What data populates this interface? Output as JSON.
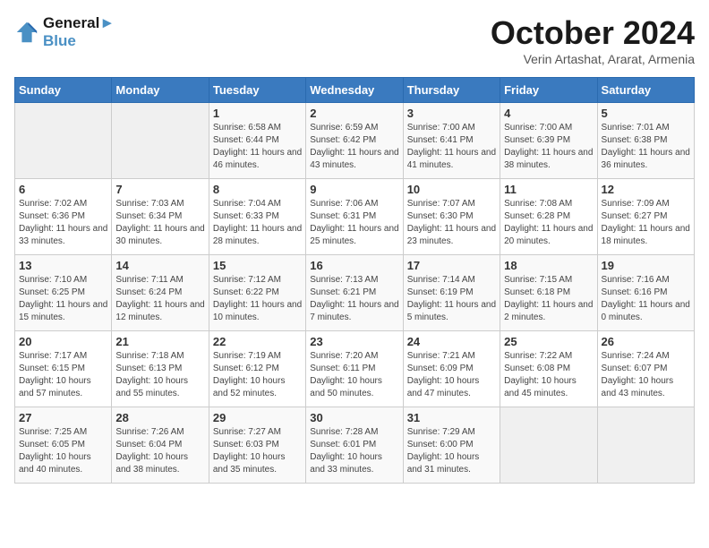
{
  "header": {
    "logo_line1": "General",
    "logo_line2": "Blue",
    "month": "October 2024",
    "location": "Verin Artashat, Ararat, Armenia"
  },
  "days_of_week": [
    "Sunday",
    "Monday",
    "Tuesday",
    "Wednesday",
    "Thursday",
    "Friday",
    "Saturday"
  ],
  "weeks": [
    [
      {
        "day": "",
        "info": ""
      },
      {
        "day": "",
        "info": ""
      },
      {
        "day": "1",
        "info": "Sunrise: 6:58 AM\nSunset: 6:44 PM\nDaylight: 11 hours and 46 minutes."
      },
      {
        "day": "2",
        "info": "Sunrise: 6:59 AM\nSunset: 6:42 PM\nDaylight: 11 hours and 43 minutes."
      },
      {
        "day": "3",
        "info": "Sunrise: 7:00 AM\nSunset: 6:41 PM\nDaylight: 11 hours and 41 minutes."
      },
      {
        "day": "4",
        "info": "Sunrise: 7:00 AM\nSunset: 6:39 PM\nDaylight: 11 hours and 38 minutes."
      },
      {
        "day": "5",
        "info": "Sunrise: 7:01 AM\nSunset: 6:38 PM\nDaylight: 11 hours and 36 minutes."
      }
    ],
    [
      {
        "day": "6",
        "info": "Sunrise: 7:02 AM\nSunset: 6:36 PM\nDaylight: 11 hours and 33 minutes."
      },
      {
        "day": "7",
        "info": "Sunrise: 7:03 AM\nSunset: 6:34 PM\nDaylight: 11 hours and 30 minutes."
      },
      {
        "day": "8",
        "info": "Sunrise: 7:04 AM\nSunset: 6:33 PM\nDaylight: 11 hours and 28 minutes."
      },
      {
        "day": "9",
        "info": "Sunrise: 7:06 AM\nSunset: 6:31 PM\nDaylight: 11 hours and 25 minutes."
      },
      {
        "day": "10",
        "info": "Sunrise: 7:07 AM\nSunset: 6:30 PM\nDaylight: 11 hours and 23 minutes."
      },
      {
        "day": "11",
        "info": "Sunrise: 7:08 AM\nSunset: 6:28 PM\nDaylight: 11 hours and 20 minutes."
      },
      {
        "day": "12",
        "info": "Sunrise: 7:09 AM\nSunset: 6:27 PM\nDaylight: 11 hours and 18 minutes."
      }
    ],
    [
      {
        "day": "13",
        "info": "Sunrise: 7:10 AM\nSunset: 6:25 PM\nDaylight: 11 hours and 15 minutes."
      },
      {
        "day": "14",
        "info": "Sunrise: 7:11 AM\nSunset: 6:24 PM\nDaylight: 11 hours and 12 minutes."
      },
      {
        "day": "15",
        "info": "Sunrise: 7:12 AM\nSunset: 6:22 PM\nDaylight: 11 hours and 10 minutes."
      },
      {
        "day": "16",
        "info": "Sunrise: 7:13 AM\nSunset: 6:21 PM\nDaylight: 11 hours and 7 minutes."
      },
      {
        "day": "17",
        "info": "Sunrise: 7:14 AM\nSunset: 6:19 PM\nDaylight: 11 hours and 5 minutes."
      },
      {
        "day": "18",
        "info": "Sunrise: 7:15 AM\nSunset: 6:18 PM\nDaylight: 11 hours and 2 minutes."
      },
      {
        "day": "19",
        "info": "Sunrise: 7:16 AM\nSunset: 6:16 PM\nDaylight: 11 hours and 0 minutes."
      }
    ],
    [
      {
        "day": "20",
        "info": "Sunrise: 7:17 AM\nSunset: 6:15 PM\nDaylight: 10 hours and 57 minutes."
      },
      {
        "day": "21",
        "info": "Sunrise: 7:18 AM\nSunset: 6:13 PM\nDaylight: 10 hours and 55 minutes."
      },
      {
        "day": "22",
        "info": "Sunrise: 7:19 AM\nSunset: 6:12 PM\nDaylight: 10 hours and 52 minutes."
      },
      {
        "day": "23",
        "info": "Sunrise: 7:20 AM\nSunset: 6:11 PM\nDaylight: 10 hours and 50 minutes."
      },
      {
        "day": "24",
        "info": "Sunrise: 7:21 AM\nSunset: 6:09 PM\nDaylight: 10 hours and 47 minutes."
      },
      {
        "day": "25",
        "info": "Sunrise: 7:22 AM\nSunset: 6:08 PM\nDaylight: 10 hours and 45 minutes."
      },
      {
        "day": "26",
        "info": "Sunrise: 7:24 AM\nSunset: 6:07 PM\nDaylight: 10 hours and 43 minutes."
      }
    ],
    [
      {
        "day": "27",
        "info": "Sunrise: 7:25 AM\nSunset: 6:05 PM\nDaylight: 10 hours and 40 minutes."
      },
      {
        "day": "28",
        "info": "Sunrise: 7:26 AM\nSunset: 6:04 PM\nDaylight: 10 hours and 38 minutes."
      },
      {
        "day": "29",
        "info": "Sunrise: 7:27 AM\nSunset: 6:03 PM\nDaylight: 10 hours and 35 minutes."
      },
      {
        "day": "30",
        "info": "Sunrise: 7:28 AM\nSunset: 6:01 PM\nDaylight: 10 hours and 33 minutes."
      },
      {
        "day": "31",
        "info": "Sunrise: 7:29 AM\nSunset: 6:00 PM\nDaylight: 10 hours and 31 minutes."
      },
      {
        "day": "",
        "info": ""
      },
      {
        "day": "",
        "info": ""
      }
    ]
  ]
}
